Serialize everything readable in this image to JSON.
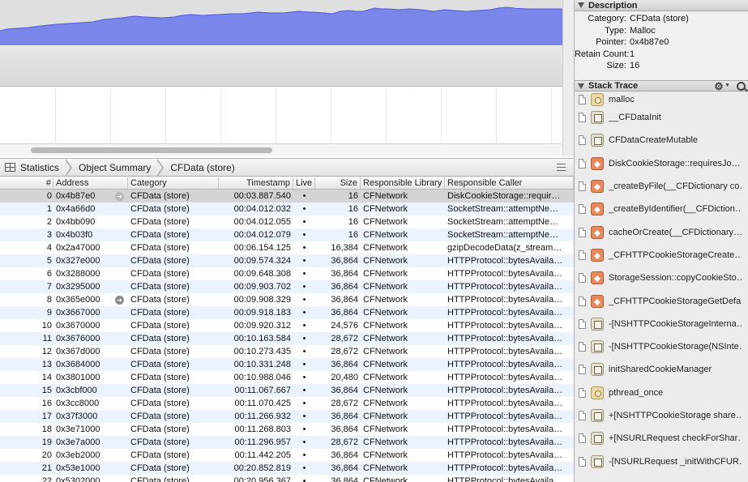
{
  "jumpbar": {
    "crumbs": [
      {
        "label": "Statistics",
        "icon": "grid-icon"
      },
      {
        "label": "Object Summary"
      },
      {
        "label": "CFData (store)"
      }
    ]
  },
  "table": {
    "headers": [
      "#",
      "Address",
      "Category",
      "Timestamp",
      "Live",
      "Size",
      "Responsible Library",
      "Responsible Caller"
    ],
    "rows": [
      {
        "num": "0",
        "addr": "0x4b87e0",
        "cat": "CFData (store)",
        "ts": "00:03.887.540",
        "live": "•",
        "size": "16",
        "lib": "CFNetwork",
        "caller": "DiskCookieStorage::requir…",
        "selected": true,
        "arrow": "light"
      },
      {
        "num": "1",
        "addr": "0x4a66d0",
        "cat": "CFData (store)",
        "ts": "00:04.012.032",
        "live": "•",
        "size": "16",
        "lib": "CFNetwork",
        "caller": "SocketStream::attemptNe…"
      },
      {
        "num": "2",
        "addr": "0x4bb090",
        "cat": "CFData (store)",
        "ts": "00:04.012.055",
        "live": "•",
        "size": "16",
        "lib": "CFNetwork",
        "caller": "SocketStream::attemptNe…"
      },
      {
        "num": "3",
        "addr": "0x4b03f0",
        "cat": "CFData (store)",
        "ts": "00:04.012.079",
        "live": "•",
        "size": "16",
        "lib": "CFNetwork",
        "caller": "SocketStream::attemptNe…"
      },
      {
        "num": "4",
        "addr": "0x2a47000",
        "cat": "CFData (store)",
        "ts": "00:06.154.125",
        "live": "•",
        "size": "16,384",
        "lib": "CFNetwork",
        "caller": "gzipDecodeData(z_stream…"
      },
      {
        "num": "5",
        "addr": "0x327e000",
        "cat": "CFData (store)",
        "ts": "00:09.574.324",
        "live": "•",
        "size": "36,864",
        "lib": "CFNetwork",
        "caller": "HTTPProtocol::bytesAvaila…"
      },
      {
        "num": "6",
        "addr": "0x3288000",
        "cat": "CFData (store)",
        "ts": "00:09.648.308",
        "live": "•",
        "size": "36,864",
        "lib": "CFNetwork",
        "caller": "HTTPProtocol::bytesAvaila…"
      },
      {
        "num": "7",
        "addr": "0x3295000",
        "cat": "CFData (store)",
        "ts": "00:09.903.702",
        "live": "•",
        "size": "36,864",
        "lib": "CFNetwork",
        "caller": "HTTPProtocol::bytesAvaila…"
      },
      {
        "num": "8",
        "addr": "0x365e000",
        "cat": "CFData (store)",
        "ts": "00:09.908.329",
        "live": "•",
        "size": "36,864",
        "lib": "CFNetwork",
        "caller": "HTTPProtocol::bytesAvaila…",
        "arrow": "dark"
      },
      {
        "num": "9",
        "addr": "0x3667000",
        "cat": "CFData (store)",
        "ts": "00:09.918.183",
        "live": "•",
        "size": "36,864",
        "lib": "CFNetwork",
        "caller": "HTTPProtocol::bytesAvaila…"
      },
      {
        "num": "10",
        "addr": "0x3670000",
        "cat": "CFData (store)",
        "ts": "00:09.920.312",
        "live": "•",
        "size": "24,576",
        "lib": "CFNetwork",
        "caller": "HTTPProtocol::bytesAvaila…"
      },
      {
        "num": "11",
        "addr": "0x3676000",
        "cat": "CFData (store)",
        "ts": "00:10.163.584",
        "live": "•",
        "size": "28,672",
        "lib": "CFNetwork",
        "caller": "HTTPProtocol::bytesAvaila…"
      },
      {
        "num": "12",
        "addr": "0x367d000",
        "cat": "CFData (store)",
        "ts": "00:10.273.435",
        "live": "•",
        "size": "28,672",
        "lib": "CFNetwork",
        "caller": "HTTPProtocol::bytesAvaila…"
      },
      {
        "num": "13",
        "addr": "0x3684000",
        "cat": "CFData (store)",
        "ts": "00:10.331.248",
        "live": "•",
        "size": "36,864",
        "lib": "CFNetwork",
        "caller": "HTTPProtocol::bytesAvaila…"
      },
      {
        "num": "14",
        "addr": "0x3801000",
        "cat": "CFData (store)",
        "ts": "00:10.988.046",
        "live": "•",
        "size": "20,480",
        "lib": "CFNetwork",
        "caller": "HTTPProtocol::bytesAvaila…"
      },
      {
        "num": "15",
        "addr": "0x3cbf000",
        "cat": "CFData (store)",
        "ts": "00:11.067.667",
        "live": "•",
        "size": "36,864",
        "lib": "CFNetwork",
        "caller": "HTTPProtocol::bytesAvaila…"
      },
      {
        "num": "16",
        "addr": "0x3cc8000",
        "cat": "CFData (store)",
        "ts": "00:11.070.425",
        "live": "•",
        "size": "28,672",
        "lib": "CFNetwork",
        "caller": "HTTPProtocol::bytesAvaila…"
      },
      {
        "num": "17",
        "addr": "0x37f3000",
        "cat": "CFData (store)",
        "ts": "00:11.266.932",
        "live": "•",
        "size": "36,864",
        "lib": "CFNetwork",
        "caller": "HTTPProtocol::bytesAvaila…"
      },
      {
        "num": "18",
        "addr": "0x3e71000",
        "cat": "CFData (store)",
        "ts": "00:11.268.803",
        "live": "•",
        "size": "36,864",
        "lib": "CFNetwork",
        "caller": "HTTPProtocol::bytesAvaila…"
      },
      {
        "num": "19",
        "addr": "0x3e7a000",
        "cat": "CFData (store)",
        "ts": "00:11.296.957",
        "live": "•",
        "size": "28,672",
        "lib": "CFNetwork",
        "caller": "HTTPProtocol::bytesAvaila…"
      },
      {
        "num": "20",
        "addr": "0x3eb2000",
        "cat": "CFData (store)",
        "ts": "00:11.442.205",
        "live": "•",
        "size": "36,864",
        "lib": "CFNetwork",
        "caller": "HTTPProtocol::bytesAvaila…"
      },
      {
        "num": "21",
        "addr": "0x53e1000",
        "cat": "CFData (store)",
        "ts": "00:20.852.819",
        "live": "•",
        "size": "36,864",
        "lib": "CFNetwork",
        "caller": "HTTPProtocol::bytesAvaila…"
      },
      {
        "num": "22",
        "addr": "0x5302000",
        "cat": "CFData (store)",
        "ts": "00:20.956.367",
        "live": "•",
        "size": "36,864",
        "lib": "CFNetwork",
        "caller": "HTTPProtocol::bytesAvaila…"
      }
    ]
  },
  "inspector": {
    "description_title": "Description",
    "description": [
      {
        "key": "Category:",
        "value": "CFData (store)"
      },
      {
        "key": "Type:",
        "value": "Malloc"
      },
      {
        "key": "Pointer:",
        "value": "0x4b87e0"
      },
      {
        "key": "Retain Count:",
        "value": "1"
      },
      {
        "key": "Size:",
        "value": "16"
      }
    ],
    "stack_title": "Stack Trace",
    "frames": [
      {
        "label": "malloc",
        "icon": "sys"
      },
      {
        "label": "__CFDataInit",
        "icon": "cf"
      },
      {
        "label": "CFDataCreateMutable",
        "icon": "cf"
      },
      {
        "label": "DiskCookieStorage::requiresJo…",
        "icon": "net"
      },
      {
        "label": "_createByFile(__CFDictionary co…",
        "icon": "net"
      },
      {
        "label": "_createByIdentifier(__CFDiction…",
        "icon": "net"
      },
      {
        "label": "cacheOrCreate(__CFDictionary…",
        "icon": "net"
      },
      {
        "label": "_CFHTTPCookieStorageCreate…",
        "icon": "net"
      },
      {
        "label": "StorageSession::copyCookieSto…",
        "icon": "net"
      },
      {
        "label": "_CFHTTPCookieStorageGetDefault",
        "icon": "net"
      },
      {
        "label": "-[NSHTTPCookieStorageInterna…",
        "icon": "cf"
      },
      {
        "label": "-[NSHTTPCookieStorage(NSInte…",
        "icon": "cf"
      },
      {
        "label": "initSharedCookieManager",
        "icon": "cf"
      },
      {
        "label": "pthread_once",
        "icon": "sys"
      },
      {
        "label": "+[NSHTTPCookieStorage share…",
        "icon": "cf"
      },
      {
        "label": "+[NSURLRequest checkForShar…",
        "icon": "cf"
      },
      {
        "label": "-[NSURLRequest _initWithCFUR…",
        "icon": "cf"
      }
    ]
  },
  "colors": {
    "graph_fill": "#7b86ea",
    "selected_row": "#d4d4d4",
    "alt_row": "#edf3fe"
  }
}
